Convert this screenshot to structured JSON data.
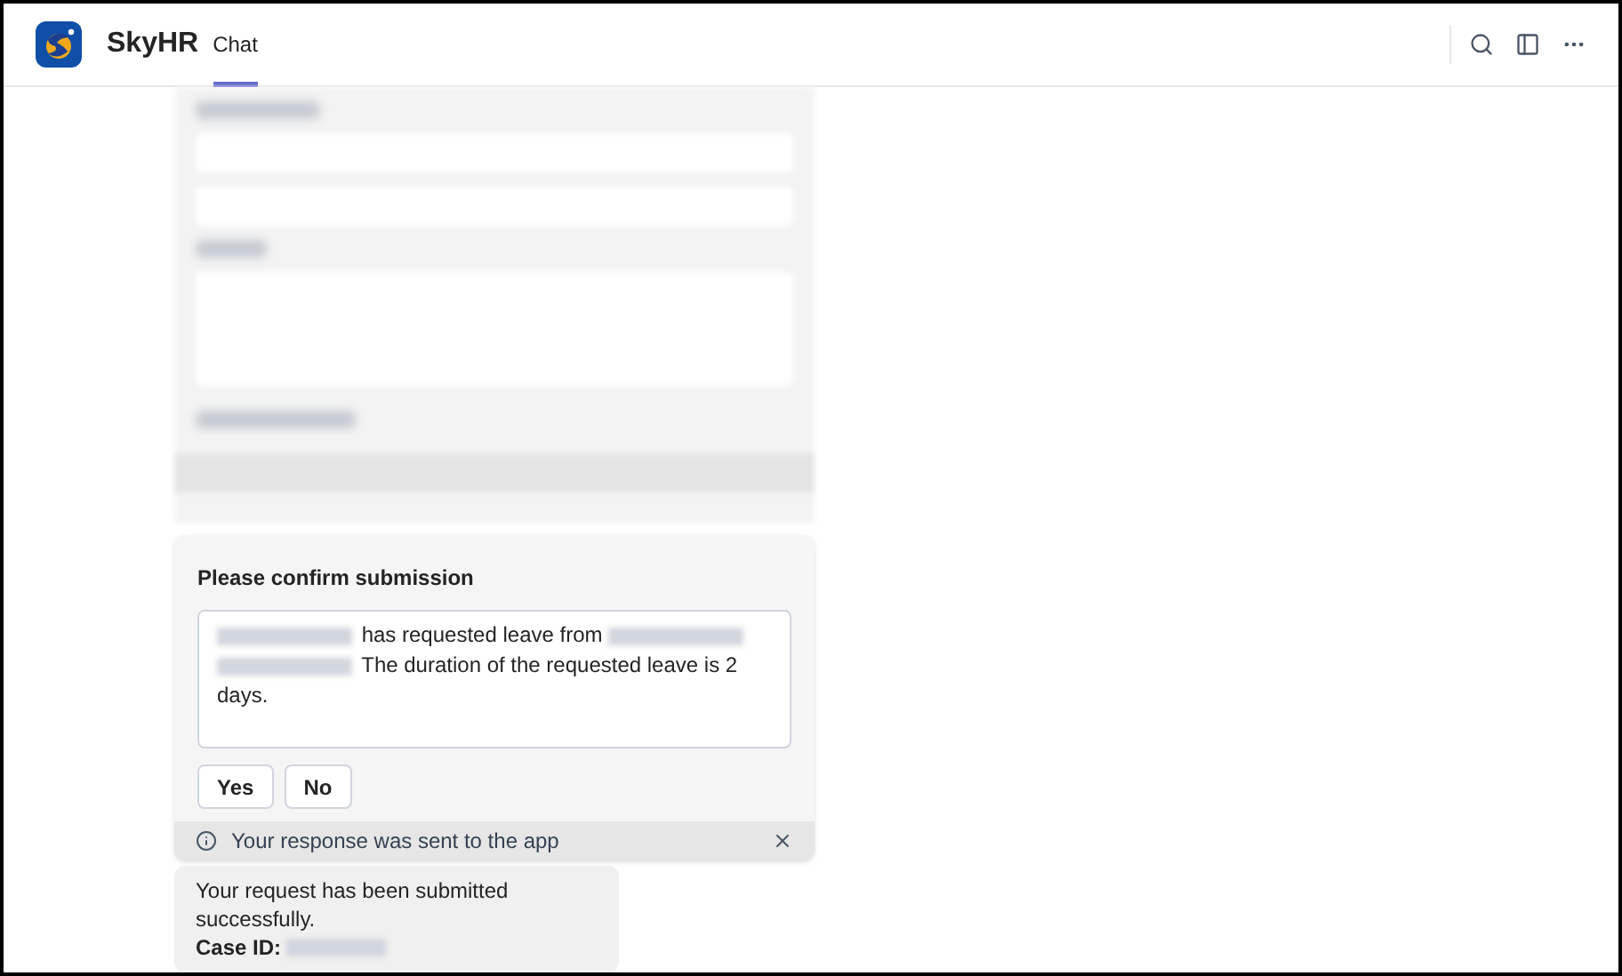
{
  "header": {
    "app_name": "SkyHR",
    "tabs": [
      {
        "label": "Chat",
        "selected": true
      }
    ]
  },
  "confirm_card": {
    "title": "Please confirm submission",
    "message": [
      {
        "kind": "redacted"
      },
      {
        "kind": "text",
        "text": " has requested leave from "
      },
      {
        "kind": "redacted"
      },
      {
        "kind": "redacted"
      },
      {
        "kind": "text",
        "text": " The duration of the requested leave is 2 days."
      }
    ],
    "buttons": [
      {
        "label": "Yes"
      },
      {
        "label": "No"
      }
    ],
    "notice": "Your response was sent to the app"
  },
  "reply": {
    "text": "Your request has been submitted successfully.",
    "case_label": "Case ID:"
  }
}
